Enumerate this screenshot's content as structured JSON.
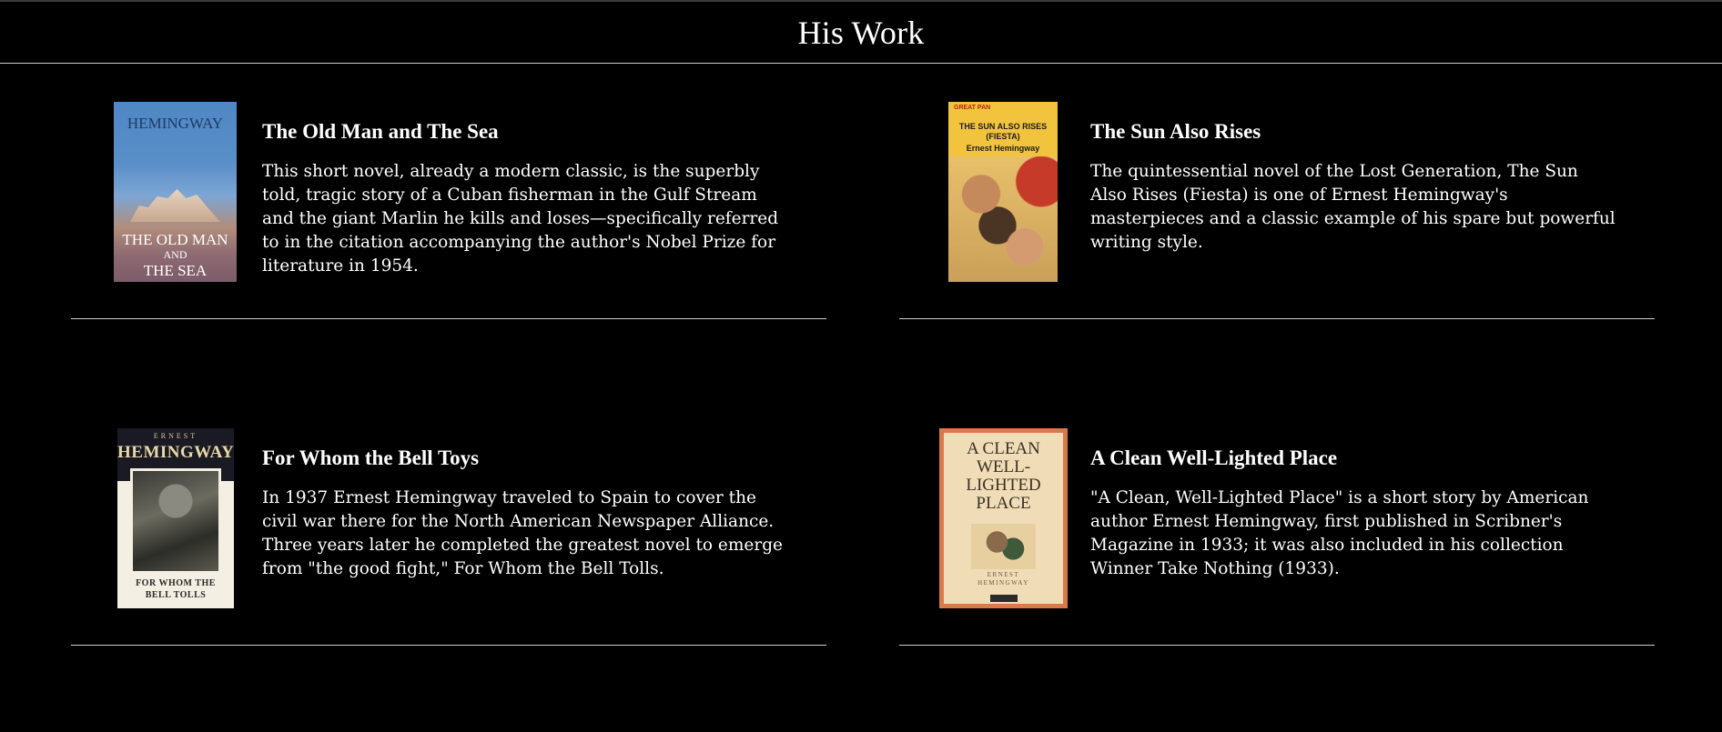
{
  "header": {
    "title": "His Work"
  },
  "books": [
    {
      "title": "The Old Man and The Sea",
      "description": "This short novel, already a modern classic, is the superbly told, tragic story of a Cuban fisherman in the Gulf Stream and the giant Marlin he kills and loses—specifically referred to in the citation accompanying the author's Nobel Prize for literature in 1954.",
      "cover": {
        "top_text": "HEMINGWAY",
        "line1": "THE OLD MAN",
        "line2": "AND",
        "line3": "THE SEA"
      }
    },
    {
      "title": "The Sun Also Rises",
      "description": "The quintessential novel of the Lost Generation, The Sun Also Rises (Fiesta) is one of Ernest Hemingway's masterpieces and a classic example of his spare but powerful writing style.",
      "cover": {
        "series": "GREAT PAN",
        "line1": "THE SUN ALSO RISES",
        "line2": "(FIESTA)",
        "author": "Ernest Hemingway"
      }
    },
    {
      "title": "For Whom the Bell Toys",
      "description": "In 1937 Ernest Hemingway traveled to Spain to cover the civil war there for the North American Newspaper Alliance. Three years later he completed the greatest novel to emerge from \"the good fight,\" For Whom the Bell Tolls.",
      "cover": {
        "top_small": "ERNEST",
        "top_big": "HEMINGWAY",
        "line1": "FOR WHOM THE",
        "line2": "BELL TOLLS"
      }
    },
    {
      "title": "A Clean Well-Lighted Place",
      "description": "\"A Clean, Well-Lighted Place\" is a short story by American author Ernest Hemingway, first published in Scribner's Magazine in 1933; it was also included in his collection Winner Take Nothing (1933).",
      "cover": {
        "line1": "A CLEAN",
        "line2": "WELL-",
        "line3": "LIGHTED",
        "line4": "PLACE",
        "author1": "ERNEST",
        "author2": "HEMINGWAY"
      }
    }
  ]
}
